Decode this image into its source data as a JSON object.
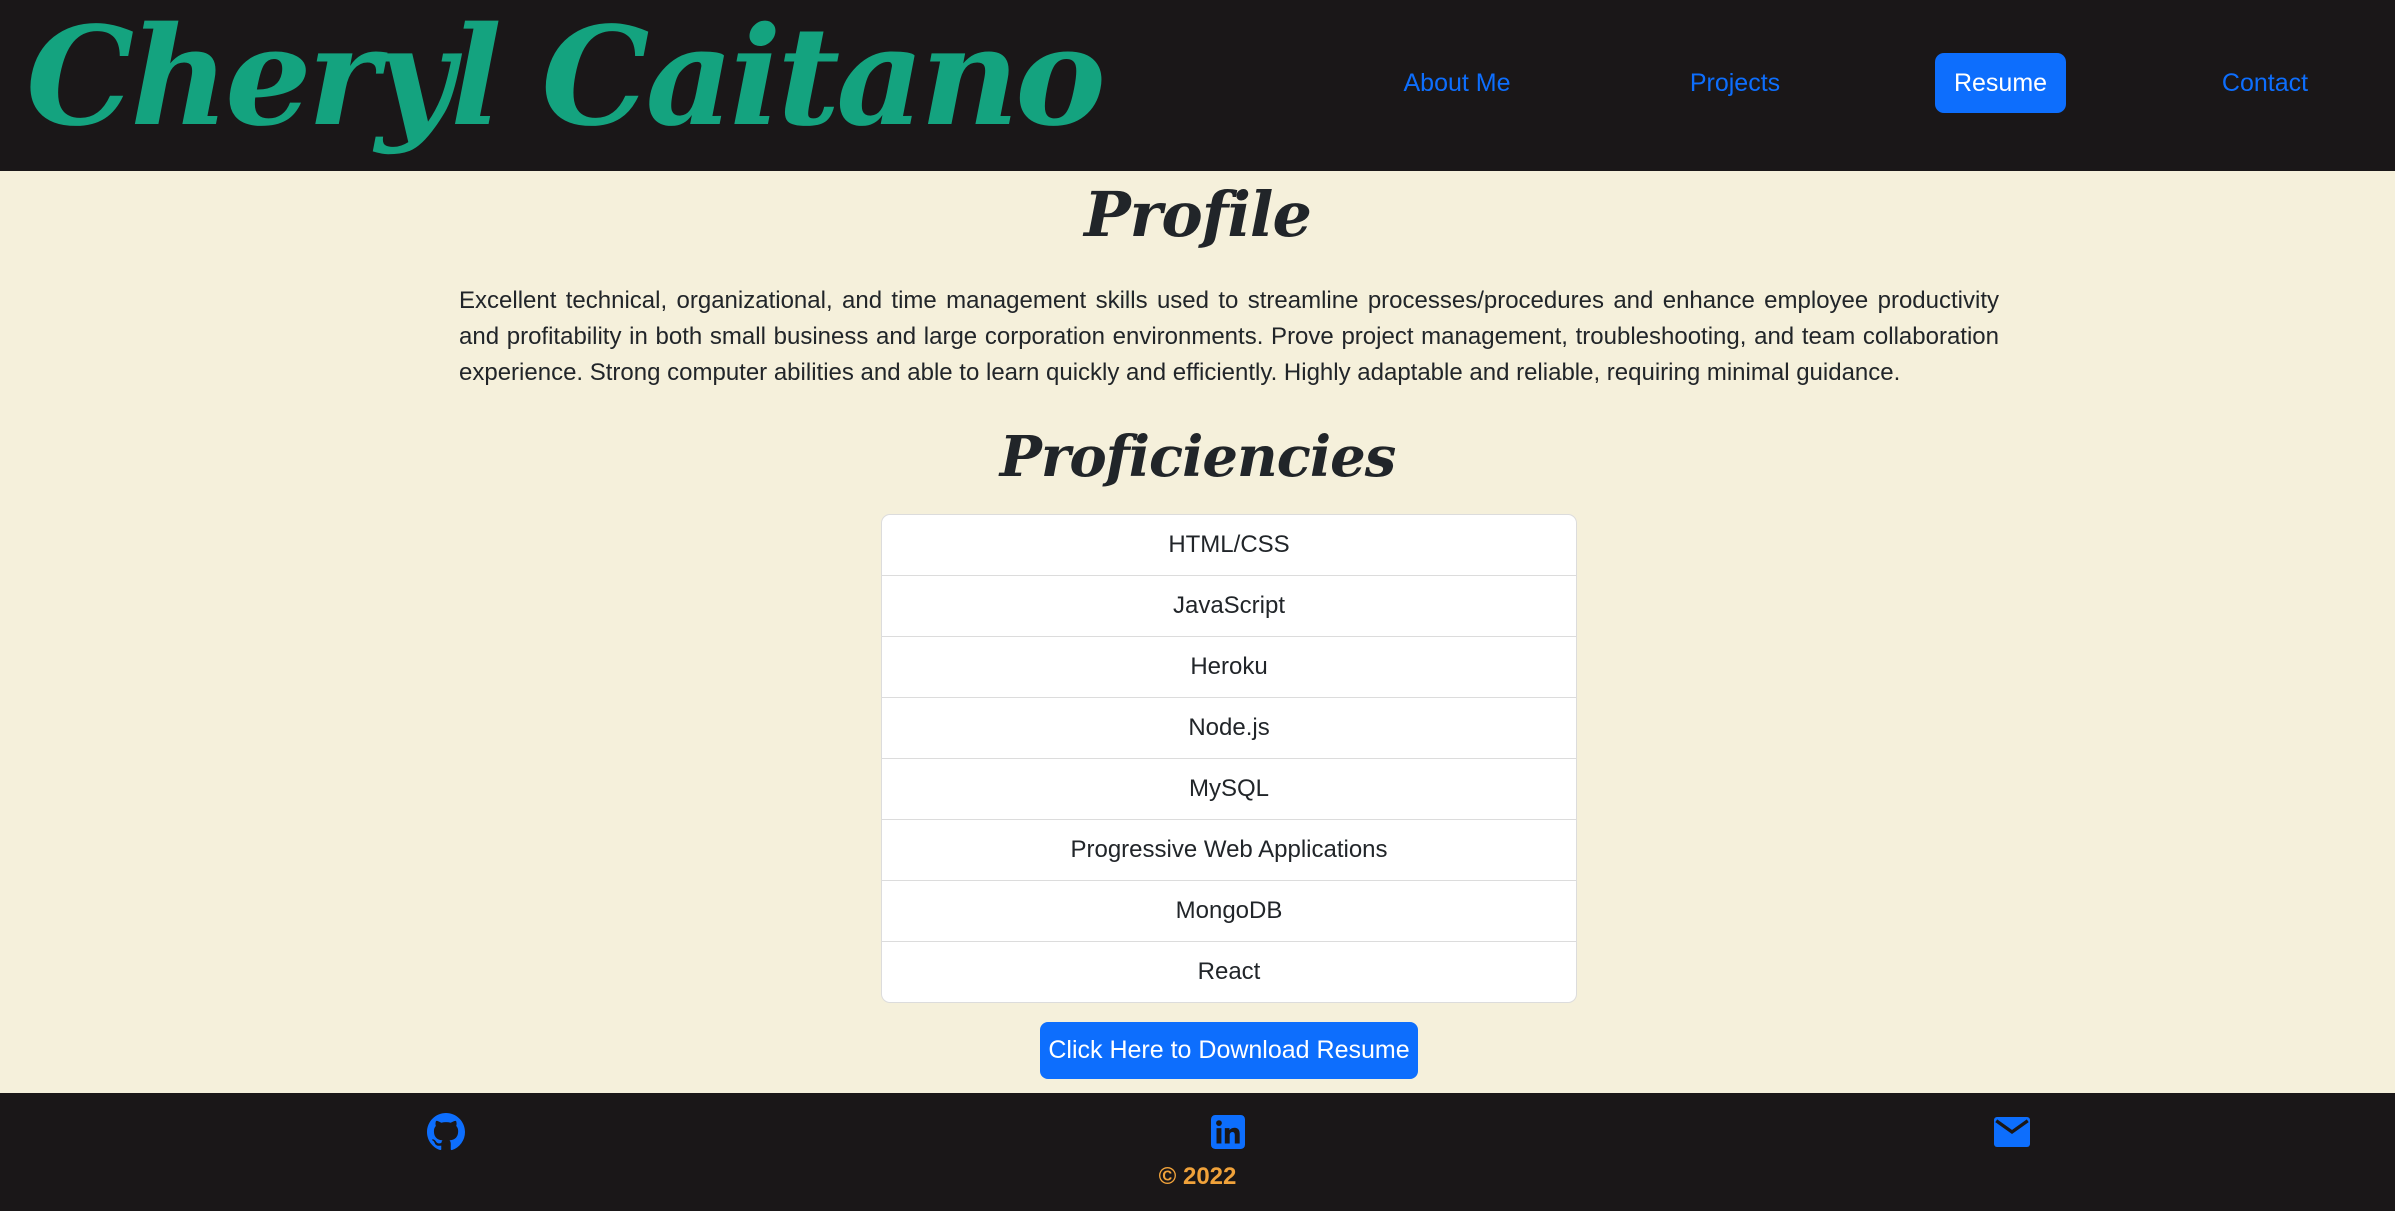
{
  "header": {
    "brand": "Cheryl Caitano",
    "nav": [
      {
        "label": "About Me",
        "active": false
      },
      {
        "label": "Projects",
        "active": false
      },
      {
        "label": "Resume",
        "active": true
      },
      {
        "label": "Contact",
        "active": false
      }
    ]
  },
  "main": {
    "profile_heading": "Profile",
    "profile_text": "Excellent technical, organizational, and time management skills used to streamline processes/procedures and enhance employee productivity and profitability in both small business and large corporation environments. Prove project management, troubleshooting, and team collaboration experience. Strong computer abilities and able to learn quickly and efficiently. Highly adaptable and reliable, requiring minimal guidance.",
    "proficiencies_heading": "Proficiencies",
    "proficiencies": [
      "HTML/CSS",
      "JavaScript",
      "Heroku",
      "Node.js",
      "MySQL",
      "Progressive Web Applications",
      "MongoDB",
      "React"
    ],
    "download_button": "Click Here to Download Resume"
  },
  "footer": {
    "icons": [
      "github-icon",
      "linkedin-icon",
      "email-icon"
    ],
    "copyright": "© 2022"
  },
  "colors": {
    "header_bg": "#1a1718",
    "brand": "#14a37f",
    "accent": "#0d6efd",
    "page_bg": "#f5f0db",
    "copyright": "#f0a23a"
  }
}
